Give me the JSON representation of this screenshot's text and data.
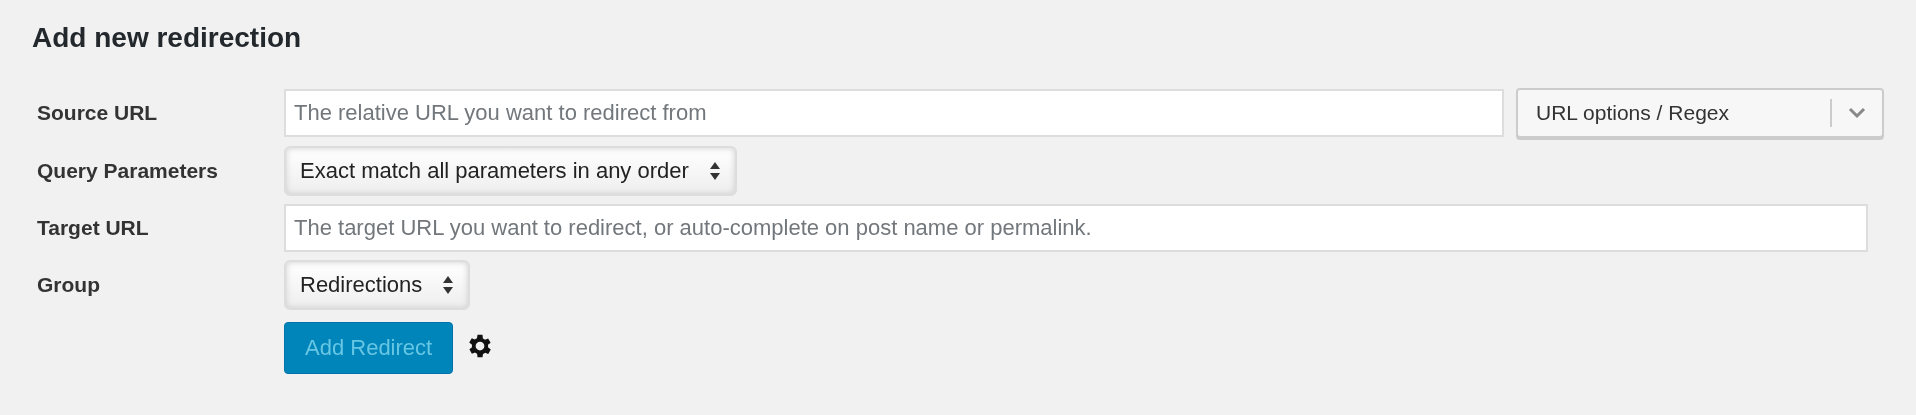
{
  "title": "Add new redirection",
  "fields": [
    {
      "kind": "input",
      "label": "Source URL",
      "placeholder": "The relative URL you want to redirect from",
      "options_button": "URL options / Regex"
    },
    {
      "kind": "select",
      "label": "Query Parameters",
      "value": "Exact match all parameters in any order"
    },
    {
      "kind": "input",
      "label": "Target URL",
      "placeholder": "The target URL you want to redirect, or auto-complete on post name or permalink."
    },
    {
      "kind": "select",
      "label": "Group",
      "value": "Redirections"
    }
  ],
  "submit": {
    "label": "Add Redirect",
    "disabled": true
  }
}
